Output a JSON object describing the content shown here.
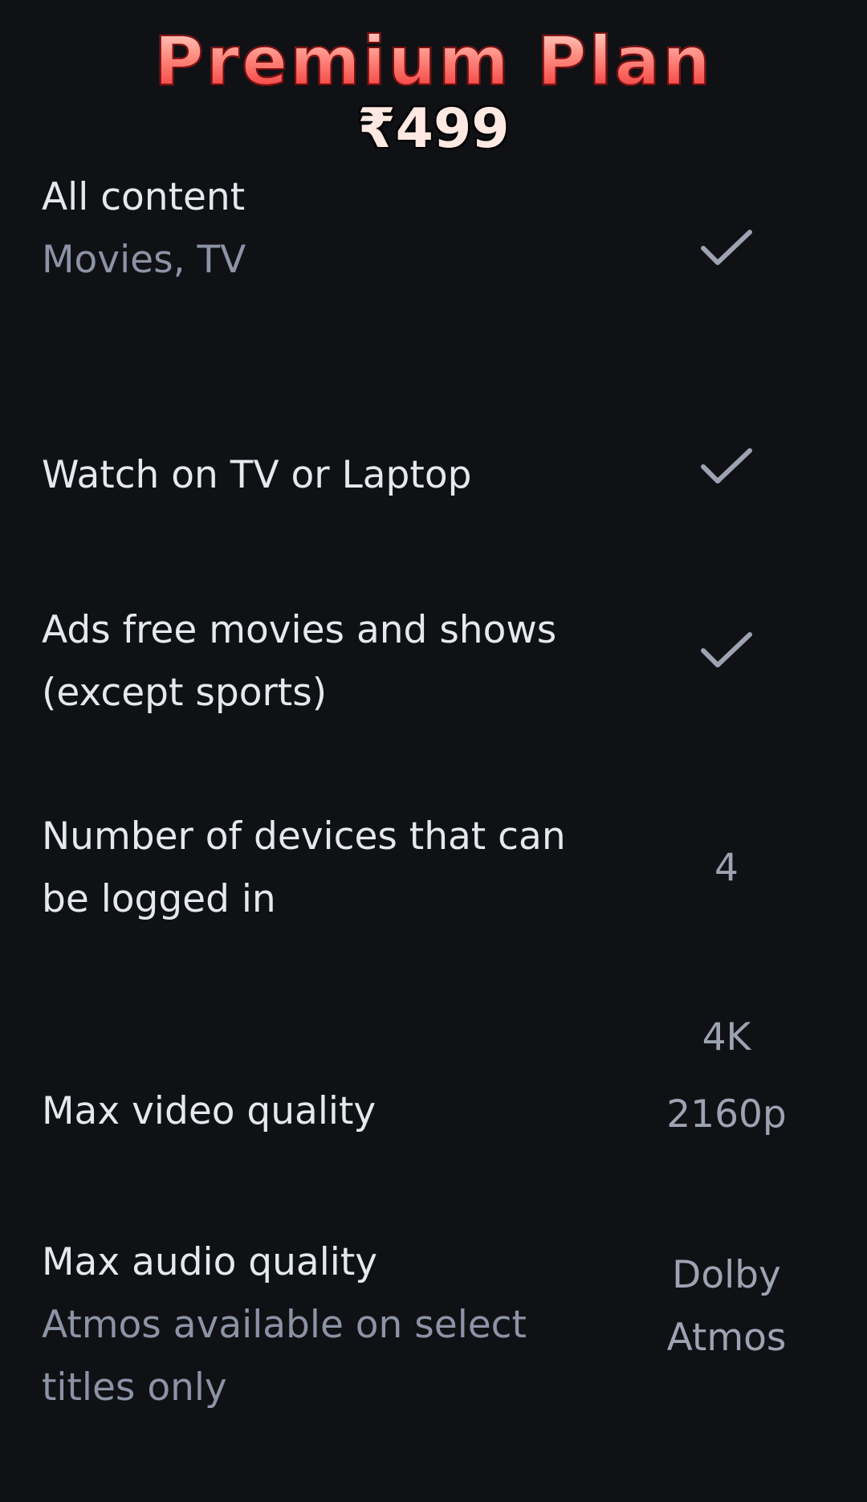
{
  "header": {
    "title": "Premium Plan",
    "price": "₹499"
  },
  "features": [
    {
      "label": "All content",
      "sub": "Movies, TV",
      "value_icon": "check-icon"
    },
    {
      "label": "Watch on TV or Laptop",
      "value_icon": "check-icon"
    },
    {
      "label_line1": "Ads free movies and shows",
      "label_line2": "(except sports)",
      "value_icon": "check-icon"
    },
    {
      "label_line1": "Number of devices that can",
      "label_line2": "be logged in",
      "value": "4"
    },
    {
      "label": "Max video quality",
      "value_line1": "4K",
      "value_line2": "2160p"
    },
    {
      "label": "Max audio quality",
      "sub_line1": "Atmos available on select",
      "sub_line2": "titles only",
      "value_line1": "Dolby",
      "value_line2": "Atmos"
    }
  ],
  "colors": {
    "background": "#0f1115",
    "primary_text": "#e6e8ee",
    "secondary_text": "#8d93a5",
    "value_text": "#9ea3b2",
    "title_gradient_top": "#ffd7cc",
    "title_gradient_bottom": "#ef2f2f"
  }
}
